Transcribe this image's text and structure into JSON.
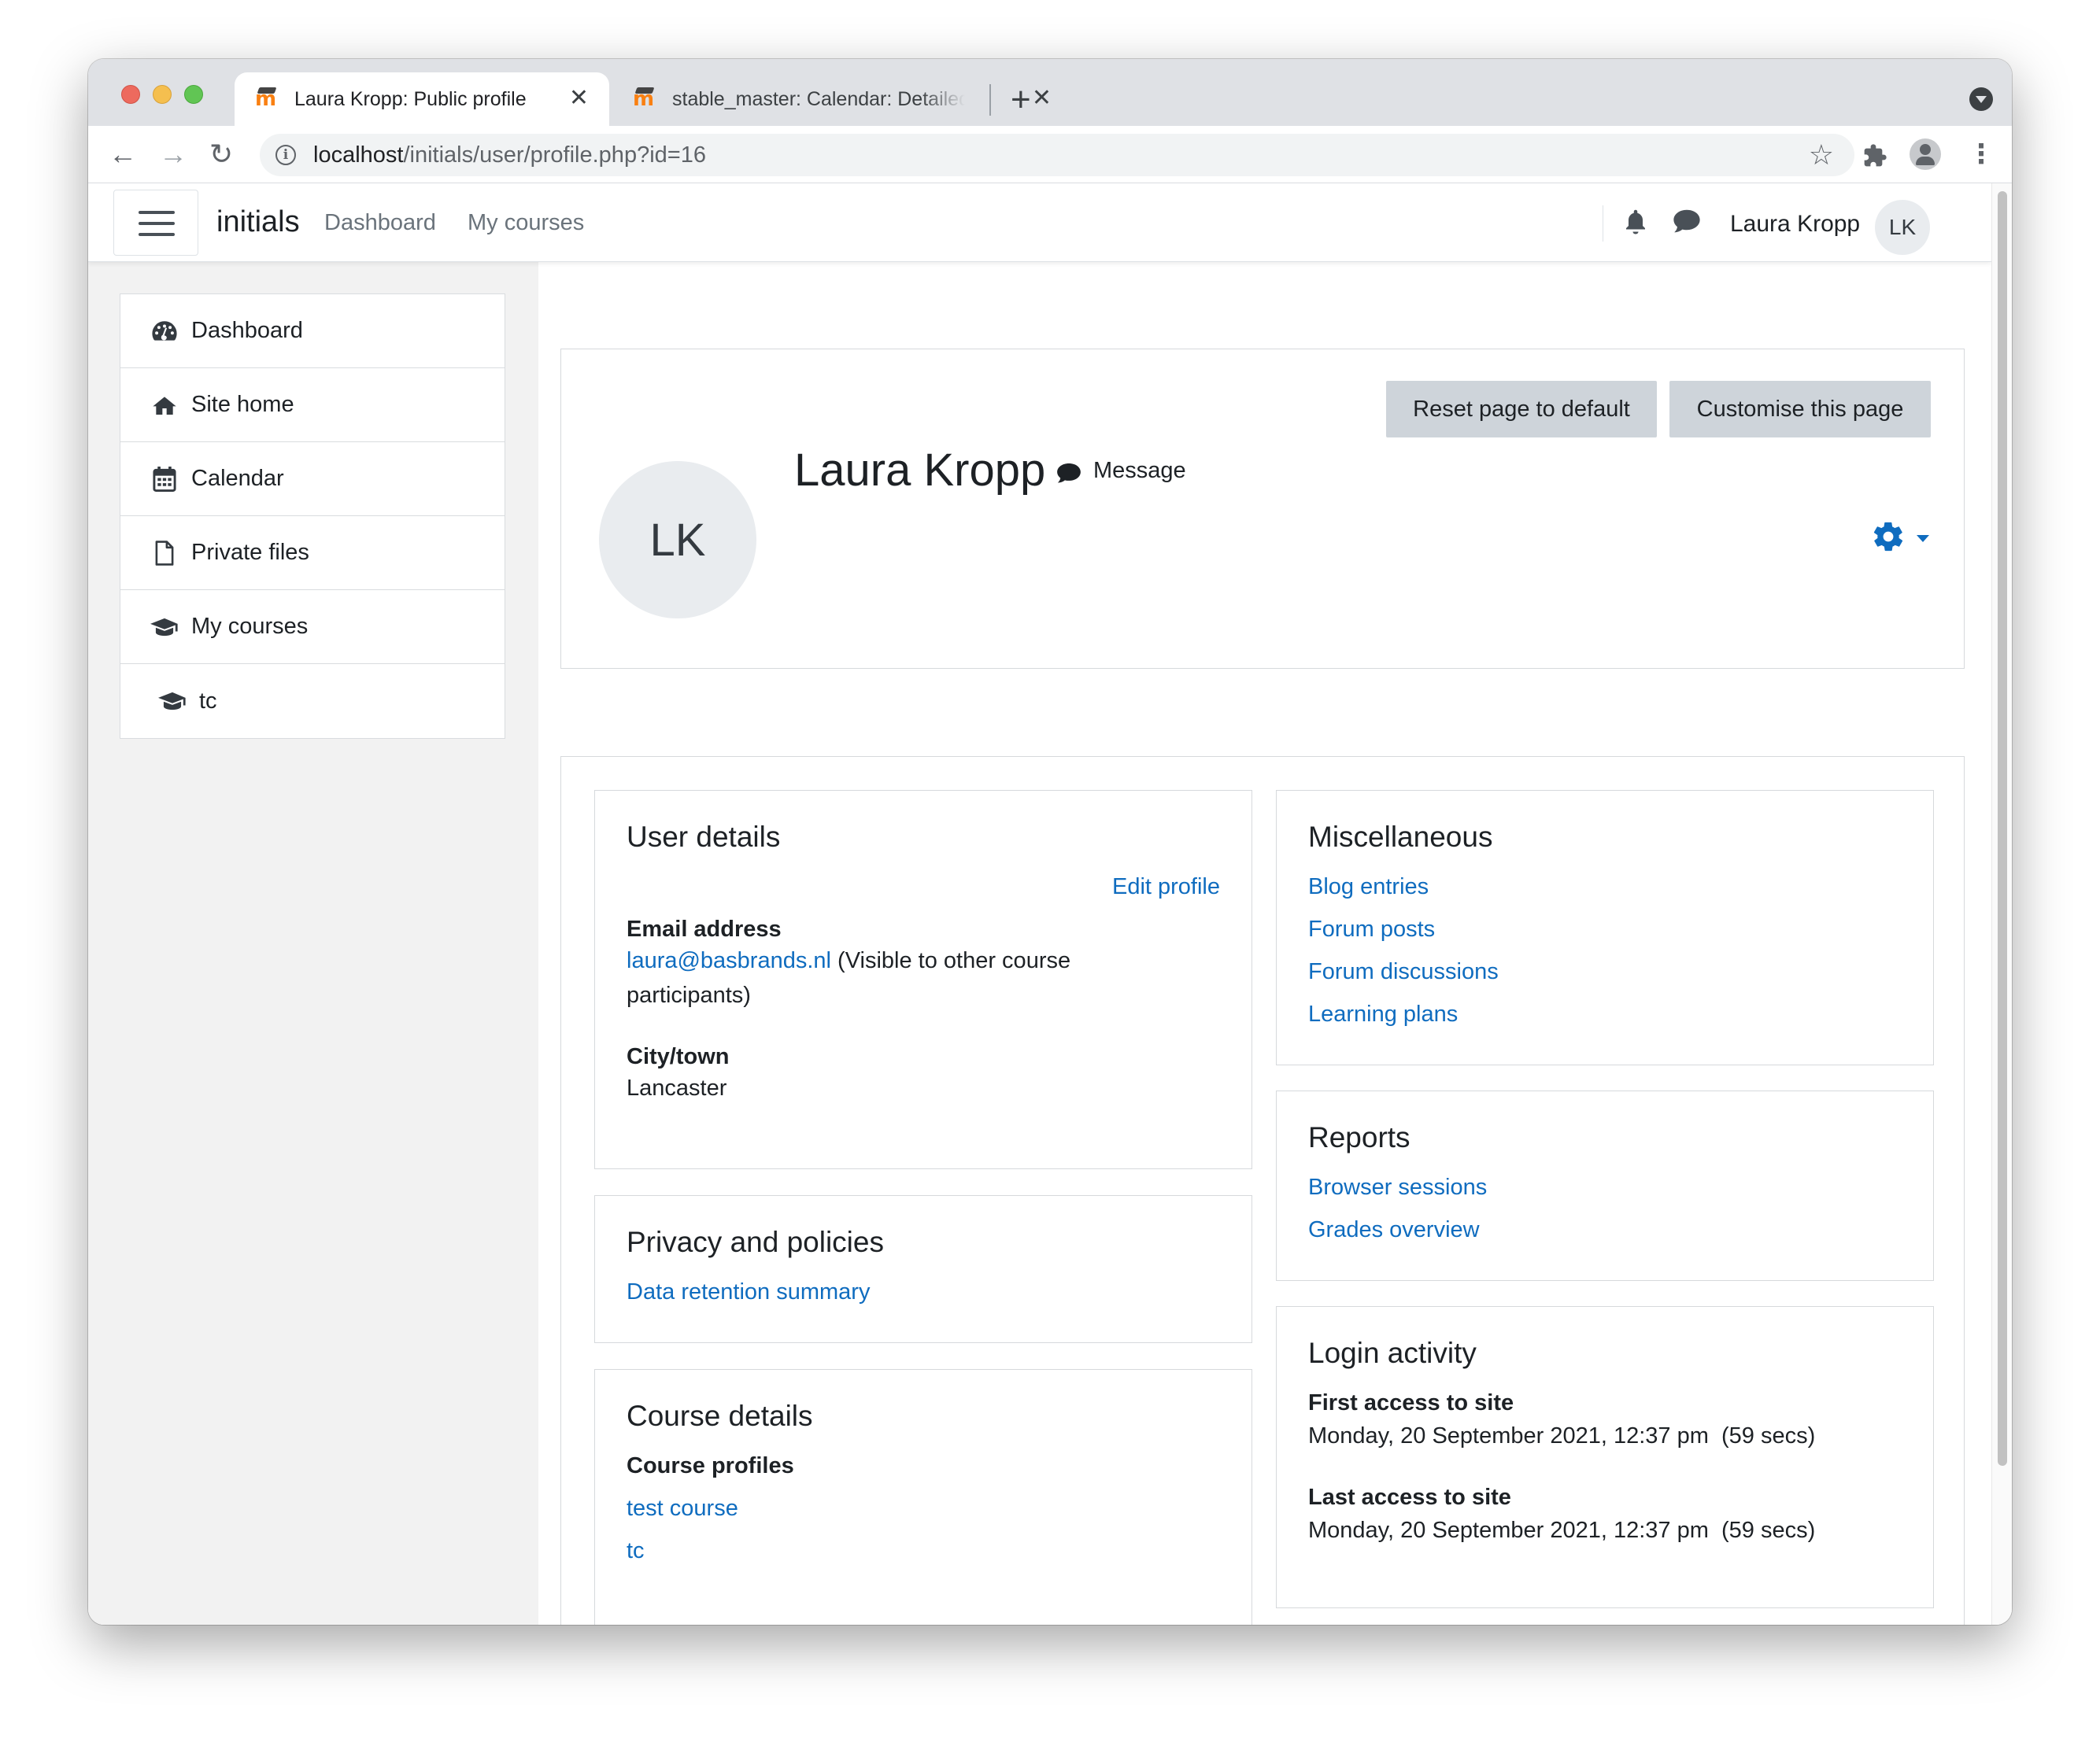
{
  "browser": {
    "tabs": [
      {
        "title": "Laura Kropp: Public profile",
        "active": true
      },
      {
        "title": "stable_master: Calendar: Detailed month view",
        "active": false
      }
    ],
    "url_host": "localhost",
    "url_path": "/initials/user/profile.php?id=16"
  },
  "navbar": {
    "brand": "initials",
    "links": [
      "Dashboard",
      "My courses"
    ],
    "user_name": "Laura Kropp",
    "user_initials": "LK"
  },
  "sidebar": {
    "items": [
      {
        "label": "Dashboard",
        "icon": "dashboard-icon"
      },
      {
        "label": "Site home",
        "icon": "home-icon"
      },
      {
        "label": "Calendar",
        "icon": "calendar-icon"
      },
      {
        "label": "Private files",
        "icon": "file-icon"
      },
      {
        "label": "My courses",
        "icon": "graduation-cap-icon"
      },
      {
        "label": "tc",
        "icon": "graduation-cap-icon"
      }
    ]
  },
  "header": {
    "reset_label": "Reset page to default",
    "customise_label": "Customise this page",
    "avatar_initials": "LK",
    "name": "Laura Kropp",
    "message_label": "Message"
  },
  "user_details": {
    "title": "User details",
    "edit_profile": "Edit profile",
    "email_label": "Email address",
    "email": "laura@basbrands.nl",
    "email_note_1": " (Visible to other course",
    "email_note_2": "participants)",
    "city_label": "City/town",
    "city": "Lancaster"
  },
  "privacy": {
    "title": "Privacy and policies",
    "link": "Data retention summary"
  },
  "course_details": {
    "title": "Course details",
    "label": "Course profiles",
    "courses": [
      "test course",
      "tc"
    ]
  },
  "miscellaneous": {
    "title": "Miscellaneous",
    "links": [
      "Blog entries",
      "Forum posts",
      "Forum discussions",
      "Learning plans"
    ]
  },
  "reports": {
    "title": "Reports",
    "links": [
      "Browser sessions",
      "Grades overview"
    ]
  },
  "login_activity": {
    "title": "Login activity",
    "first_label": "First access to site",
    "first_value": "Monday, 20 September 2021, 12:37 pm  (59 secs)",
    "last_label": "Last access to site",
    "last_value": "Monday, 20 September 2021, 12:37 pm  (59 secs)"
  },
  "colors": {
    "link": "#0f6cbf",
    "button_bg": "#ced4da",
    "text": "#1d2125"
  }
}
